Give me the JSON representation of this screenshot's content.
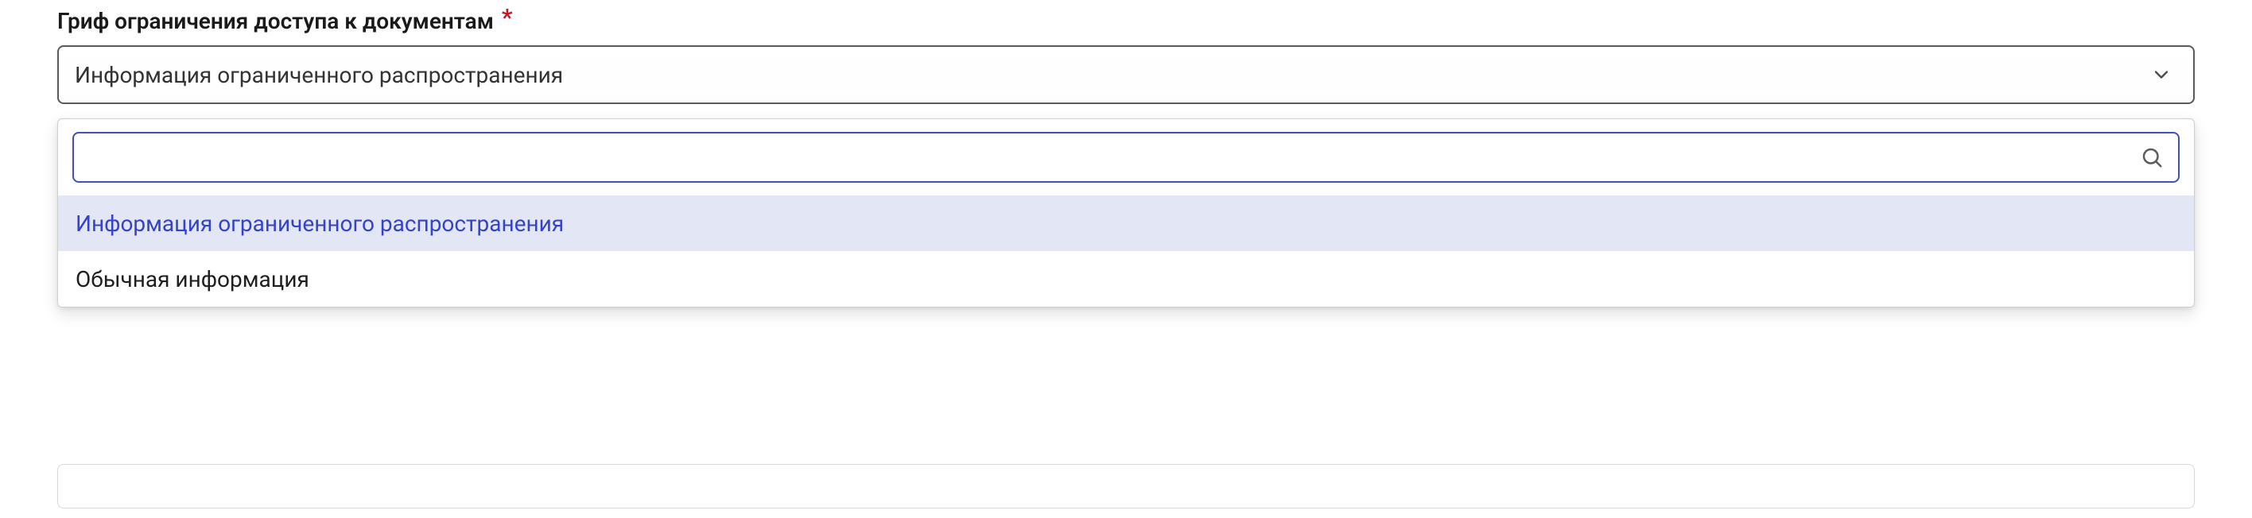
{
  "field": {
    "label": "Гриф ограничения доступа к документам",
    "required_marker": "*",
    "selected_value": "Информация ограниченного распространения"
  },
  "dropdown": {
    "search_value": "",
    "search_placeholder": "",
    "options": [
      {
        "label": "Информация ограниченного распространения",
        "selected": true
      },
      {
        "label": "Обычная информация",
        "selected": false
      }
    ]
  },
  "secondary_input": {
    "value": "",
    "placeholder": ""
  }
}
